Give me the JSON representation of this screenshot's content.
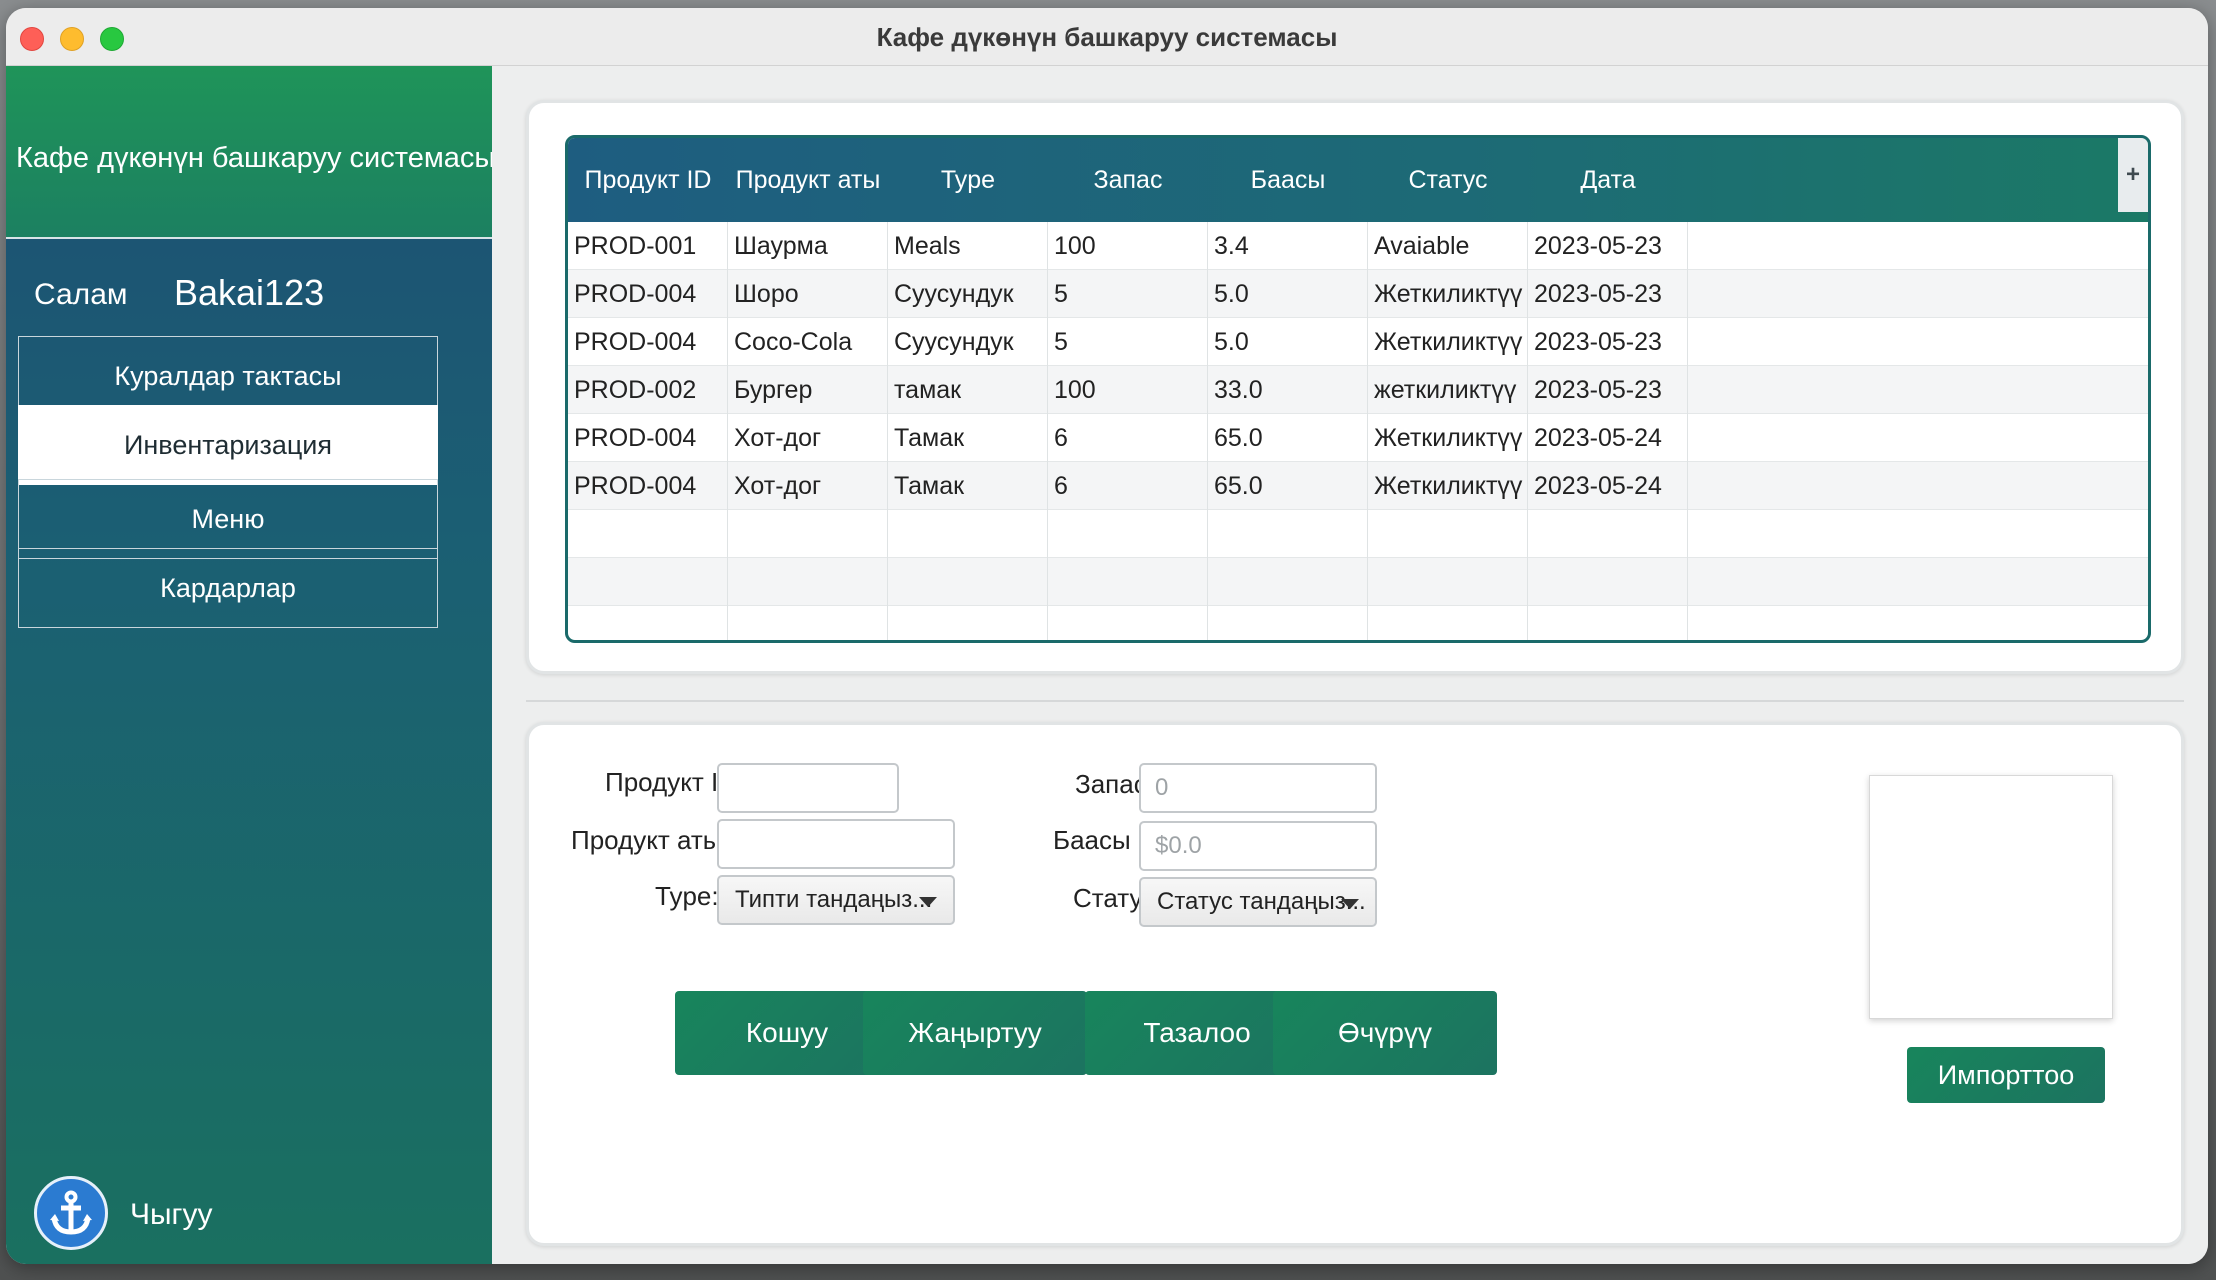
{
  "window": {
    "title": "Кафе дүкөнүн башкаруу системасы"
  },
  "sidebar": {
    "app_title": "Кафе дүкөнүн башкаруу системасы",
    "greeting": "Салам",
    "username": "Bakai123",
    "nav": [
      "Куралдар тактасы",
      "Инвентаризация",
      "Меню",
      "Кардарлар"
    ],
    "active_nav": "Инвентаризация",
    "logout_label": "Чыгуу",
    "logout_icon": "anchor-icon"
  },
  "table": {
    "columns": [
      "Продукт ID",
      "Продукт аты",
      "Type",
      "Запас",
      "Баасы",
      "Статус",
      "Дата"
    ],
    "column_menu_icon": "plus-icon",
    "rows": [
      [
        "PROD-001",
        "Шаурма",
        "Meals",
        "100",
        "3.4",
        "Avaiable",
        "2023-05-23"
      ],
      [
        "PROD-004",
        "Шоро",
        "Суусундук",
        "5",
        "5.0",
        "Жеткиликтүү",
        "2023-05-23"
      ],
      [
        "PROD-004",
        "Coco-Cola",
        "Суусундук",
        "5",
        "5.0",
        "Жеткиликтүү",
        "2023-05-23"
      ],
      [
        "PROD-002",
        "Бургер",
        "тамак",
        "100",
        "33.0",
        "жеткиликтүү",
        "2023-05-23"
      ],
      [
        "PROD-004",
        "Хот-дог",
        "Тамак",
        "6",
        "65.0",
        "Жеткиликтүү",
        "2023-05-24"
      ],
      [
        "PROD-004",
        "Хот-дог",
        "Тамак",
        "6",
        "65.0",
        "Жеткиликтүү",
        "2023-05-24"
      ]
    ],
    "empty_rows": 3
  },
  "form": {
    "product_id_label": "Продукт ID:",
    "product_id_value": "",
    "product_name_label": "Продукт аты:",
    "product_name_value": "",
    "type_label": "Type:",
    "type_selected": "Типти тандаңыз...",
    "stock_label": "Запас:",
    "stock_placeholder": "0",
    "price_label": "Баасы ($):",
    "price_placeholder": "$0.0",
    "status_label": "Статус:",
    "status_selected": "Статус тандаңыз...",
    "import_label": "Импорттоо",
    "add_label": "Кошуу",
    "update_label": "Жаңыртуу",
    "clear_label": "Тазалоо",
    "delete_label": "Өчүрүү"
  },
  "colors": {
    "accent_green": "#18855c",
    "sidebar_blue": "#1d4f73",
    "header_green": "#1f9459"
  }
}
